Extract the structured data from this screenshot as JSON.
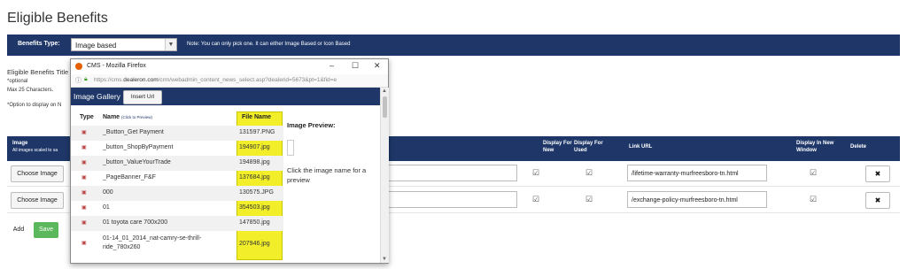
{
  "page": {
    "title": "Eligible Benefits",
    "benefits_type_label": "Benefits Type:",
    "benefits_type_value": "Image based",
    "benefits_type_note": "Note: You can only pick one. It can either Image Based or Icon Based",
    "eligible_title_label": "Eligible Benefits Title",
    "optional_note": "*optional",
    "max_chars": "Max 25 Characters.",
    "option_note": "*Option to display on N"
  },
  "grid": {
    "headers": {
      "image": "Image",
      "image_sub": "All images scaled to sa",
      "display_new": "Display For New",
      "display_used": "Display For Used",
      "link_url": "Link URL",
      "display_new_window": "Display In New Window",
      "delete": "Delete"
    },
    "rows": [
      {
        "choose_label": "Choose Image",
        "link": "/lifetime-warranty-murfreesboro-tn.html"
      },
      {
        "choose_label": "Choose Image",
        "link": "/exchange-policy-murfreesboro-tn.html"
      }
    ],
    "add_label": "Add",
    "save_label": "Save"
  },
  "popup": {
    "window_title": "CMS - Mozilla Firefox",
    "url_prefix": "https://cms.",
    "url_domain": "dealeron.com",
    "url_rest": "/crm/webadmin_content_news_select.asp?dealerid=5673&pt=1&fid=e",
    "gallery_title": "Image Gallery",
    "insert_url_label": "Insert Url",
    "col_type": "Type",
    "col_name": "Name",
    "col_name_hint": "(Click to Preview)",
    "col_filename": "File Name",
    "preview_label": "Image Preview:",
    "preview_hint": "Click the image name for a preview",
    "files": [
      {
        "name": "_Button_Get Payment",
        "file": "131597.PNG"
      },
      {
        "name": "_button_ShopByPayment",
        "file": "194907.jpg"
      },
      {
        "name": "_button_ValueYourTrade",
        "file": "194898.jpg"
      },
      {
        "name": "_PageBanner_F&F",
        "file": "137684.jpg"
      },
      {
        "name": "000",
        "file": "130575.JPG"
      },
      {
        "name": "01",
        "file": "354503.jpg"
      },
      {
        "name": "01 toyota care 700x200",
        "file": "147850.jpg"
      },
      {
        "name": "01-14_01_2014_nat-camry-se-thrill-ride_780x260",
        "file": "207946.jpg"
      }
    ]
  },
  "colors": {
    "navy": "#1e3768",
    "highlight": "#f2ef2a",
    "save_green": "#5cb85c"
  }
}
